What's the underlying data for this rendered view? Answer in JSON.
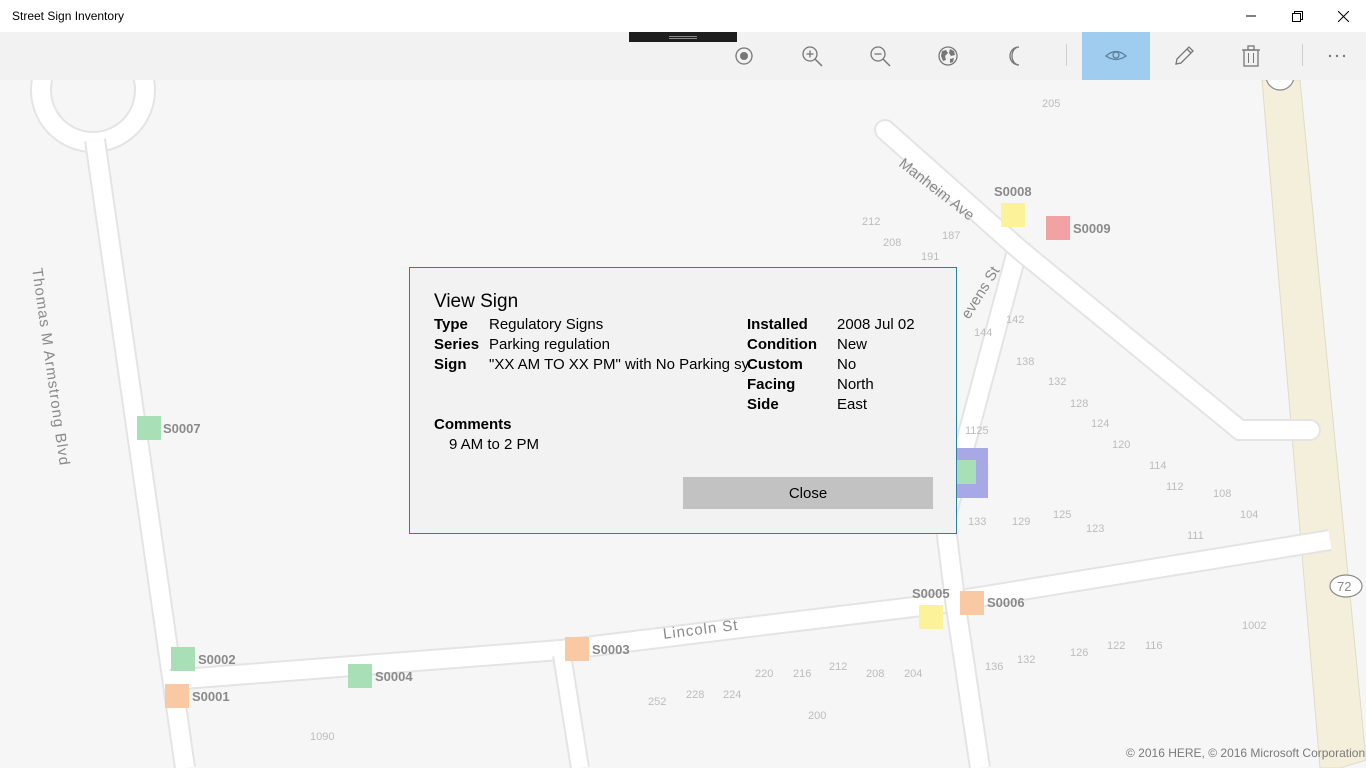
{
  "window": {
    "title": "Street Sign Inventory"
  },
  "toolbar": {
    "buttons": [
      {
        "icon": "location-icon"
      },
      {
        "icon": "zoom-in-icon"
      },
      {
        "icon": "zoom-out-icon"
      },
      {
        "icon": "globe-icon"
      },
      {
        "icon": "moon-icon"
      },
      {
        "icon": "eye-icon",
        "active": true
      },
      {
        "icon": "pencil-icon"
      },
      {
        "icon": "trash-icon"
      },
      {
        "icon": "more-icon"
      }
    ],
    "active_color": "#9fcdf0"
  },
  "map": {
    "streets": [
      "Thomas M Armstrong Blvd",
      "Manheim Ave",
      "evens St",
      "Lincoln St"
    ],
    "route_shield": "72",
    "address_numbers": [
      "205",
      "212",
      "208",
      "187",
      "191",
      "144",
      "142",
      "138",
      "132",
      "128",
      "124",
      "120",
      "114",
      "112",
      "108",
      "104",
      "1125",
      "133",
      "129",
      "125",
      "123",
      "111",
      "1002",
      "136",
      "132",
      "126",
      "122",
      "116",
      "220",
      "216",
      "212",
      "208",
      "204",
      "252",
      "228",
      "224",
      "200",
      "1090"
    ],
    "signs": [
      {
        "id": "S0001",
        "color": "#f9c9a3"
      },
      {
        "id": "S0002",
        "color": "#a8dfb6"
      },
      {
        "id": "S0003",
        "color": "#f9c9a3"
      },
      {
        "id": "S0004",
        "color": "#a8dfb6"
      },
      {
        "id": "S0005",
        "color": "#fbf29a"
      },
      {
        "id": "S0006",
        "color": "#f9c9a3"
      },
      {
        "id": "S0007",
        "color": "#a8dfb6"
      },
      {
        "id": "S0008",
        "color": "#fbf29a"
      },
      {
        "id": "S0009",
        "color": "#f2a2a2"
      }
    ],
    "selected_sign_color": "#a8a8e6",
    "copyright": "© 2016 HERE, © 2016 Microsoft Corporation"
  },
  "dialog": {
    "title": "View Sign",
    "labels": {
      "type": "Type",
      "series": "Series",
      "sign": "Sign",
      "installed": "Installed",
      "condition": "Condition",
      "custom": "Custom",
      "facing": "Facing",
      "side": "Side",
      "comments": "Comments"
    },
    "values": {
      "type": "Regulatory Signs",
      "series": "Parking regulation",
      "sign": "\"XX AM TO XX PM\" with No Parking sym",
      "installed": "2008 Jul 02",
      "condition": "New",
      "custom": "No",
      "facing": "North",
      "side": "East",
      "comments": "9 AM to 2 PM"
    },
    "close_label": "Close"
  }
}
